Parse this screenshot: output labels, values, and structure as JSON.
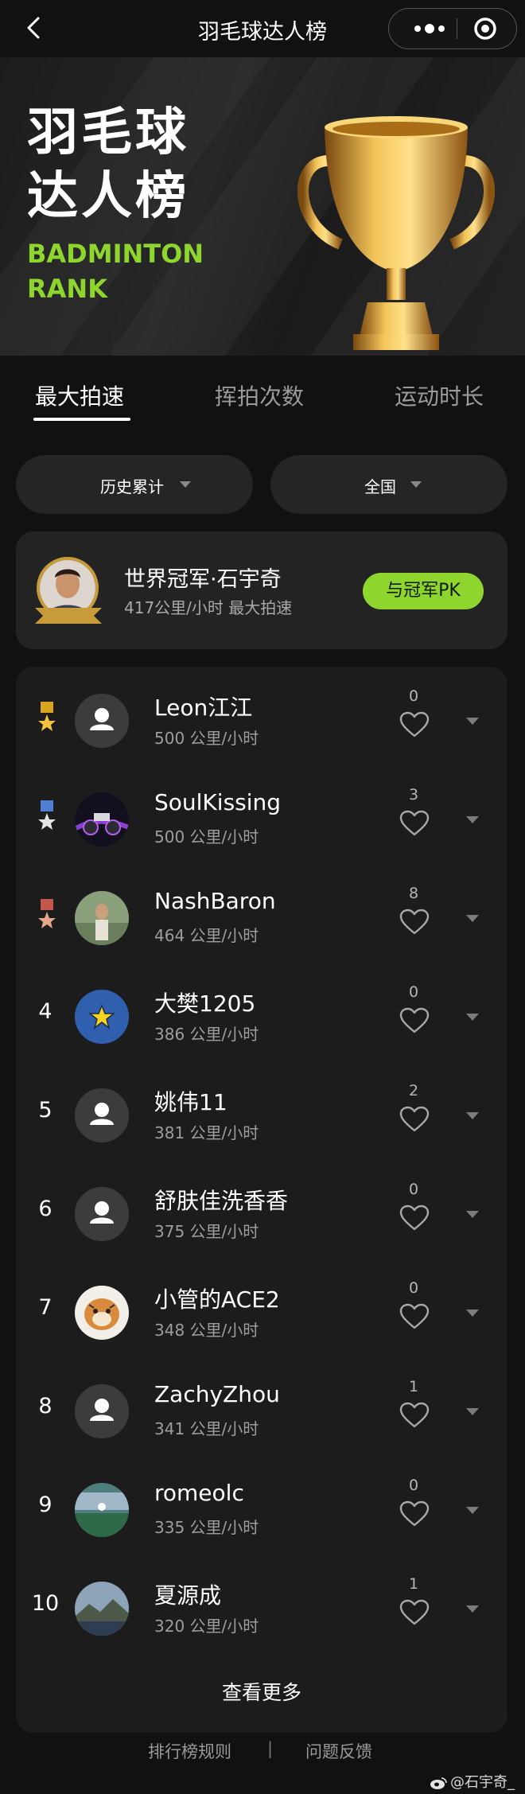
{
  "navbar": {
    "title": "羽毛球达人榜"
  },
  "hero": {
    "title_line1": "羽毛球",
    "title_line2": "达人榜",
    "sub_line1": "BADMINTON",
    "sub_line2": "RANK"
  },
  "tabs": [
    {
      "label": "最大拍速",
      "active": true
    },
    {
      "label": "挥拍次数",
      "active": false
    },
    {
      "label": "运动时长",
      "active": false
    }
  ],
  "filters": {
    "time_range": "历史累计",
    "region": "全国"
  },
  "champion": {
    "name": "世界冠军·石宇奇",
    "meta": "417公里/小时 最大拍速",
    "badge": "冠军",
    "pk_button": "与冠军PK"
  },
  "ranking": [
    {
      "rank": "1",
      "medal": "gold",
      "name": "Leon江江",
      "speed": "500 公里/小时",
      "likes": "0",
      "avatar": "default"
    },
    {
      "rank": "2",
      "medal": "silver",
      "name": "SoulKissing",
      "speed": "500 公里/小时",
      "likes": "3",
      "avatar": "motorbike"
    },
    {
      "rank": "3",
      "medal": "bronze",
      "name": "NashBaron",
      "speed": "464 公里/小时",
      "likes": "8",
      "avatar": "photo"
    },
    {
      "rank": "4",
      "medal": "",
      "name": "大樊1205",
      "speed": "386 公里/小时",
      "likes": "0",
      "avatar": "star"
    },
    {
      "rank": "5",
      "medal": "",
      "name": "姚伟11",
      "speed": "381 公里/小时",
      "likes": "2",
      "avatar": "default"
    },
    {
      "rank": "6",
      "medal": "",
      "name": "舒肤佳洗香香",
      "speed": "375 公里/小时",
      "likes": "0",
      "avatar": "default"
    },
    {
      "rank": "7",
      "medal": "",
      "name": "小管的ACE2",
      "speed": "348 公里/小时",
      "likes": "0",
      "avatar": "tiger"
    },
    {
      "rank": "8",
      "medal": "",
      "name": "ZachyZhou",
      "speed": "341 公里/小时",
      "likes": "1",
      "avatar": "default"
    },
    {
      "rank": "9",
      "medal": "",
      "name": "romeolc",
      "speed": "335 公里/小时",
      "likes": "0",
      "avatar": "court"
    },
    {
      "rank": "10",
      "medal": "",
      "name": "夏源成",
      "speed": "320 公里/小时",
      "likes": "1",
      "avatar": "landscape"
    }
  ],
  "more_label": "查看更多",
  "footer": {
    "rules": "排行榜规则",
    "separator": "|",
    "feedback": "问题反馈"
  },
  "watermark": "@石宇奇_",
  "colors": {
    "accent": "#8ed52e",
    "background": "#111112",
    "card": "#1c1c1d",
    "gold": "#c79a3a"
  }
}
